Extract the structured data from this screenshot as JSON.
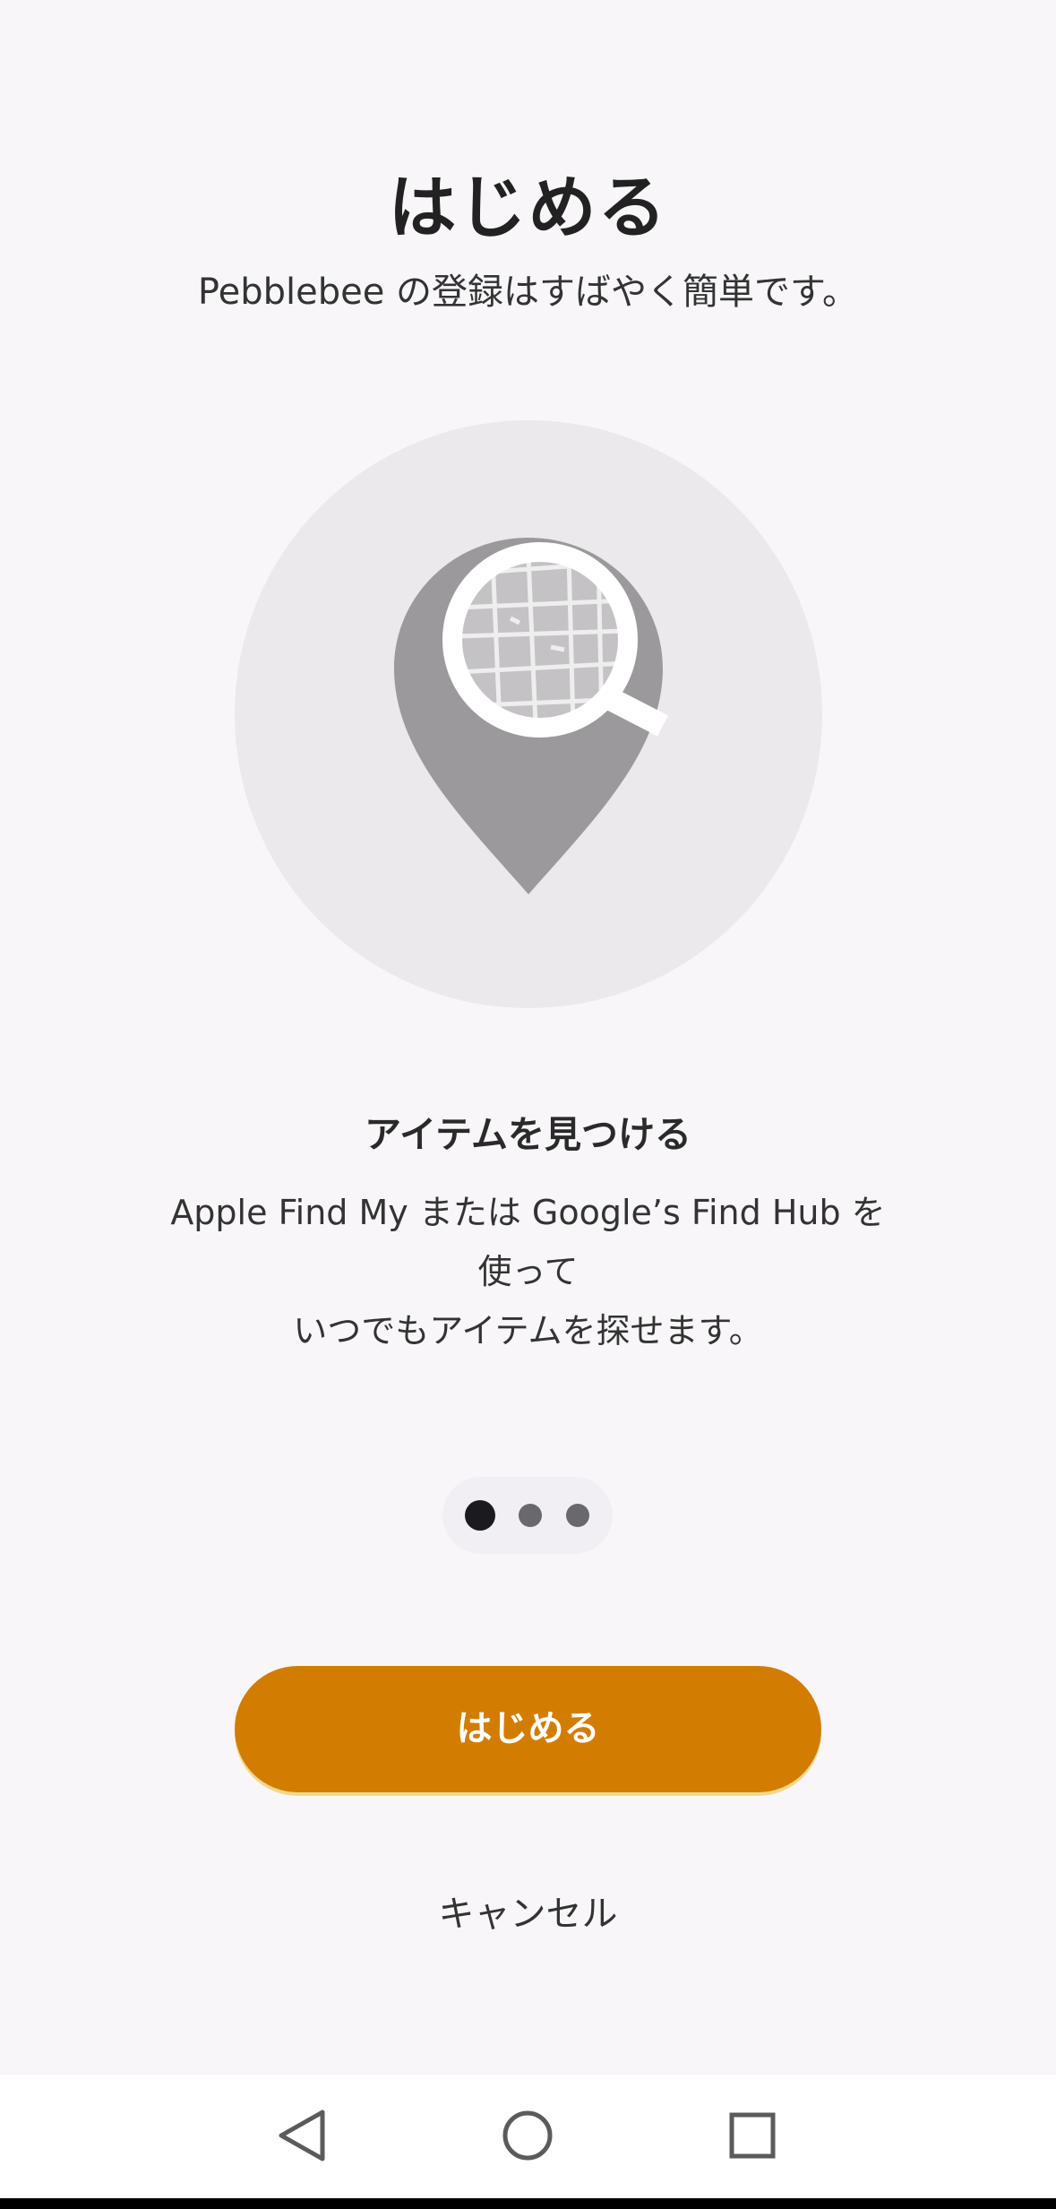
{
  "header": {
    "title": "はじめる",
    "subtitle": "Pebblebee の登録はすばやく簡単です。"
  },
  "illustration": {
    "icon": "map-pin-search-icon",
    "circle_color": "#ebe9ec",
    "pin_color": "#9b999c"
  },
  "feature": {
    "title": "アイテムを見つける",
    "description_lines": [
      "Apple Find My または Google’s Find Hub を",
      "使って",
      "いつでもアイテムを探せます。"
    ]
  },
  "pager": {
    "total": 3,
    "current": 1
  },
  "actions": {
    "start_label": "はじめる",
    "cancel_label": "キャンセル",
    "accent_color": "#d27d00"
  },
  "system_nav": {
    "back_icon": "back-triangle-icon",
    "home_icon": "home-circle-icon",
    "recents_icon": "recents-square-icon"
  }
}
